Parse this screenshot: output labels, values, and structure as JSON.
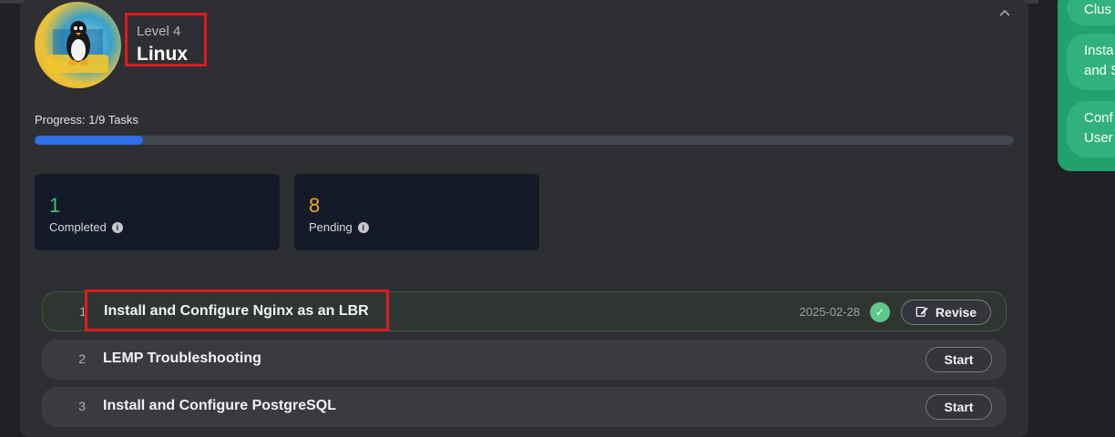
{
  "level": {
    "label": "Level 4",
    "name": "Linux"
  },
  "progress": {
    "label": "Progress: 1/9 Tasks",
    "fraction": 0.111
  },
  "stats": {
    "completed": {
      "count": "1",
      "label": "Completed",
      "color": "#3ec46d"
    },
    "pending": {
      "count": "8",
      "label": "Pending",
      "color": "#f5a623"
    }
  },
  "tasks": [
    {
      "num": "1",
      "title": "Install and Configure Nginx as an LBR",
      "date": "2025-02-28",
      "action": "Revise",
      "done": true
    },
    {
      "num": "2",
      "title": "LEMP Troubleshooting",
      "action": "Start",
      "done": false
    },
    {
      "num": "3",
      "title": "Install and Configure PostgreSQL",
      "action": "Start",
      "done": false
    }
  ],
  "side_panel": {
    "items": [
      "Clus",
      "Insta\nand S",
      "Conf\nUser"
    ]
  },
  "colors": {
    "accent": "#2f6fe8",
    "highlight": "#e0191f",
    "success": "#5ec98a"
  },
  "icons": {
    "collapse": "chevron-up-icon",
    "info": "info-icon",
    "check": "check-icon",
    "edit": "edit-icon"
  }
}
